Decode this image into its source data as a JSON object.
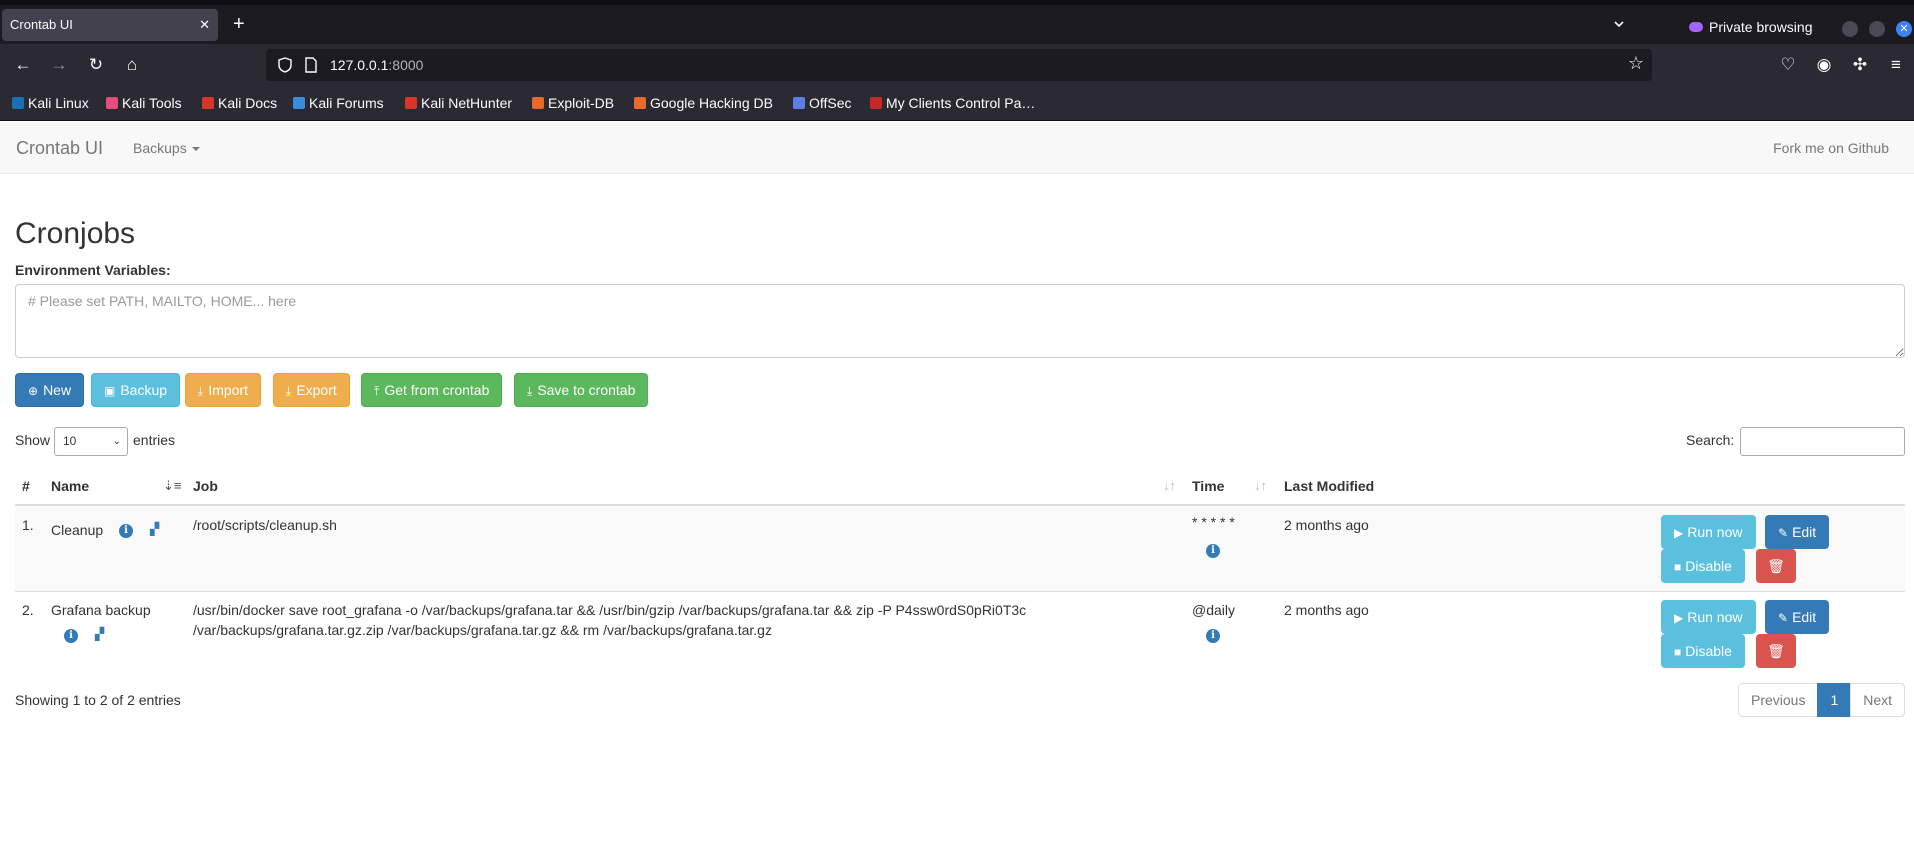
{
  "browser": {
    "tab_title": "Crontab UI",
    "tab_close": "✕",
    "new_tab": "+",
    "private_label": "Private browsing",
    "url_host": "127.0.0.1",
    "url_port": ":8000",
    "bookmarks": [
      {
        "label": "Kali Linux",
        "color": "#1a6fb5"
      },
      {
        "label": "Kali Tools",
        "color": "#e44d7a"
      },
      {
        "label": "Kali Docs",
        "color": "#d9362b"
      },
      {
        "label": "Kali Forums",
        "color": "#3a8ddc"
      },
      {
        "label": "Kali NetHunter",
        "color": "#d9362b"
      },
      {
        "label": "Exploit-DB",
        "color": "#e8692c"
      },
      {
        "label": "Google Hacking DB",
        "color": "#e8692c"
      },
      {
        "label": "OffSec",
        "color": "#5e7de6"
      },
      {
        "label": "My Clients Control Pa…",
        "color": "#c62828"
      }
    ]
  },
  "app": {
    "brand": "Crontab UI",
    "backups_menu": "Backups",
    "fork_link": "Fork me on Github",
    "page_title": "Cronjobs",
    "env_label": "Environment Variables:",
    "env_placeholder": "# Please set PATH, MAILTO, HOME... here",
    "toolbar": {
      "new": "New",
      "backup": "Backup",
      "import": "Import",
      "export": "Export",
      "get_from_crontab": "Get from crontab",
      "save_to_crontab": "Save to crontab"
    },
    "show_label": "Show",
    "entries_value": "10",
    "entries_label": "entries",
    "search_label": "Search:",
    "columns": {
      "index": "#",
      "name": "Name",
      "job": "Job",
      "time": "Time",
      "last_modified": "Last Modified"
    },
    "rows": [
      {
        "index": "1.",
        "name": "Cleanup",
        "job": "/root/scripts/cleanup.sh",
        "time": "* * * * *",
        "last_modified": "2 months ago"
      },
      {
        "index": "2.",
        "name": "Grafana backup",
        "job": "/usr/bin/docker save root_grafana -o /var/backups/grafana.tar && /usr/bin/gzip /var/backups/grafana.tar && zip -P P4ssw0rdS0pRi0T3c /var/backups/grafana.tar.gz.zip /var/backups/grafana.tar.gz && rm /var/backups/grafana.tar.gz",
        "time": "@daily",
        "last_modified": "2 months ago"
      }
    ],
    "row_buttons": {
      "run_now": "Run now",
      "edit": "Edit",
      "disable": "Disable"
    },
    "footer_info": "Showing 1 to 2 of 2 entries",
    "pagination": {
      "previous": "Previous",
      "current": "1",
      "next": "Next"
    }
  }
}
